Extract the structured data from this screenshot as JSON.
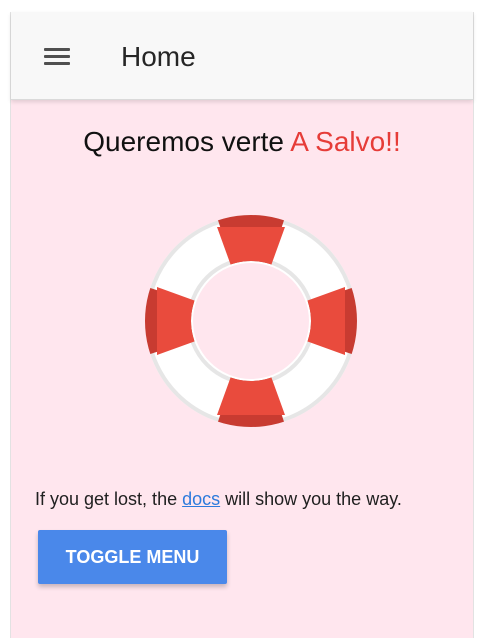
{
  "header": {
    "title": "Home",
    "menu_icon": "hamburger-menu-icon"
  },
  "hero": {
    "title_prefix": "Queremos verte ",
    "title_accent": "A Salvo!!",
    "image_icon": "life-ring-icon"
  },
  "message": {
    "prefix": "If you get lost, the ",
    "link": "docs",
    "suffix": " will show you the way."
  },
  "toggle_button": {
    "label": "TOGGLE MENU"
  },
  "colors": {
    "page_background": "#ffe6ee",
    "toolbar_background": "#f8f8f8",
    "accent": "#e63c38",
    "life_ring_red": "#e94b3d",
    "life_ring_dark_red": "#c83b31",
    "life_ring_white": "#ffffff",
    "life_ring_gray": "#e6e6e6",
    "button_blue": "#4a88ea",
    "link_blue": "#2d7bdc"
  }
}
